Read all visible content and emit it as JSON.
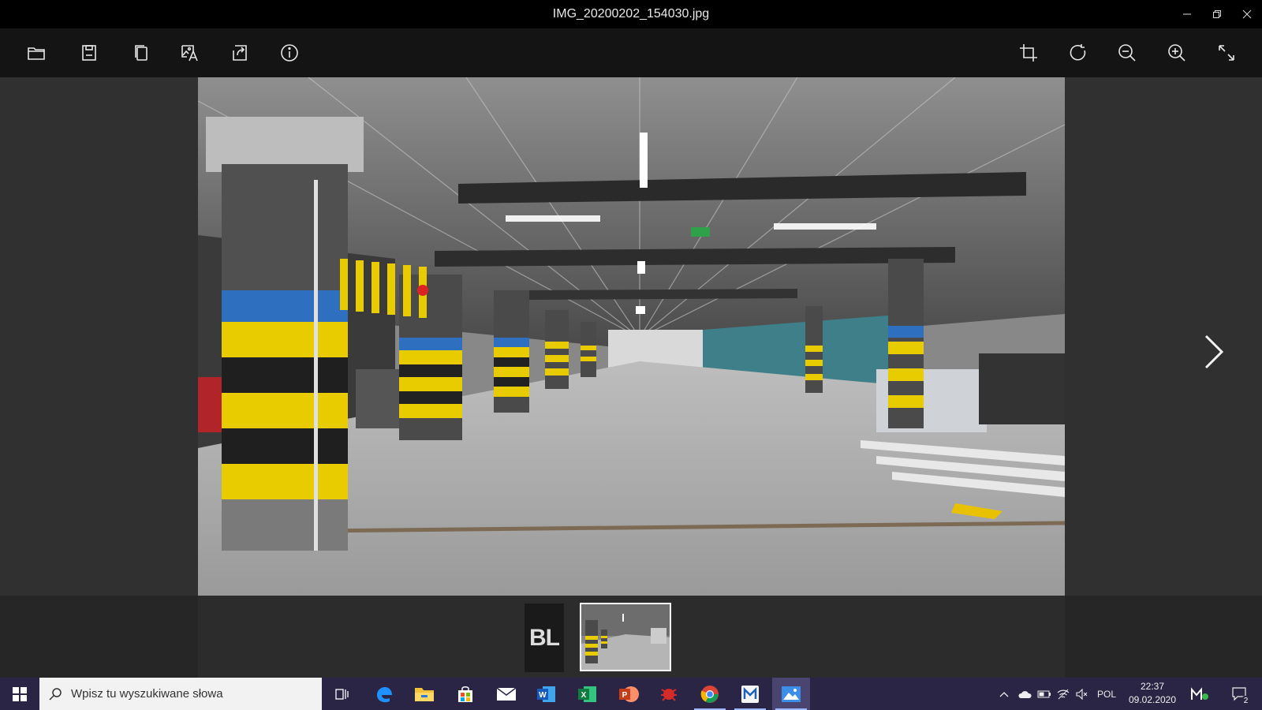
{
  "window": {
    "title": "IMG_20200202_154030.jpg",
    "minimize_icon": "minimize-icon",
    "restore_icon": "restore-icon",
    "close_icon": "close-icon"
  },
  "toolbar": {
    "left": [
      "folder-icon",
      "save-icon",
      "copy-icon",
      "image-text-icon",
      "share-icon",
      "info-icon"
    ],
    "right": [
      "crop-icon",
      "rotate-icon",
      "zoom-out-icon",
      "zoom-in-icon",
      "fullscreen-icon"
    ]
  },
  "filmstrip": {
    "thumb1_text": "BL"
  },
  "taskbar": {
    "search_placeholder": "Wpisz tu wyszukiwane słowa",
    "language": "POL",
    "time": "22:37",
    "date": "09.02.2020",
    "notifications_count": "2",
    "apps": [
      "task-view",
      "edge",
      "file-explorer",
      "store",
      "mail",
      "word",
      "excel",
      "powerpoint",
      "app-red",
      "chrome",
      "app-blue",
      "photos"
    ]
  },
  "colors": {
    "taskbar": "#2b2545",
    "toolbar": "#141414",
    "viewer_bg": "#303030",
    "accent": "#9fb7ff"
  }
}
